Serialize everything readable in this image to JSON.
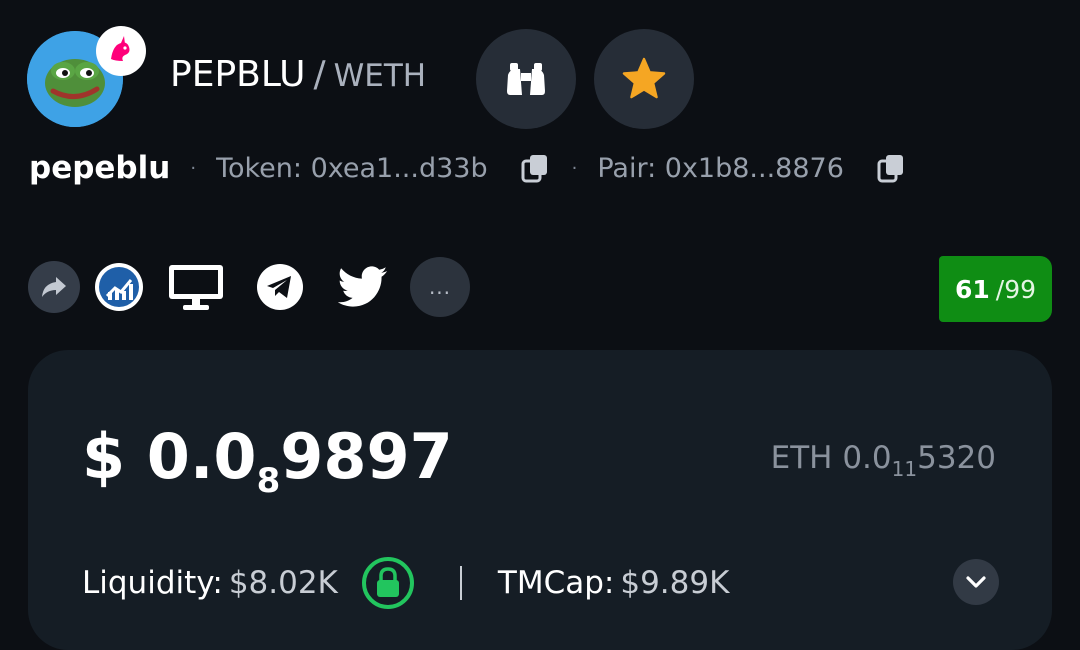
{
  "header": {
    "base_symbol": "PEPBLU",
    "separator": "/",
    "quote_symbol": "WETH",
    "token_name": "pepeblu",
    "token_address": "Token: 0xea1...d33b",
    "pair_address": "Pair: 0x1b8...8876",
    "dot": "·"
  },
  "links": {
    "more_label": "..."
  },
  "score": {
    "value": "61",
    "total": "/99"
  },
  "price": {
    "usd_prefix": "$ 0.0",
    "usd_zeros": "8",
    "usd_digits": "9897",
    "eth_prefix": "ETH 0.0",
    "eth_zeros": "11",
    "eth_digits": "5320"
  },
  "stats": {
    "liquidity_label": "Liquidity:",
    "liquidity_value": "$8.02K",
    "tmcap_label": "TMCap:",
    "tmcap_value": "$9.89K"
  },
  "colors": {
    "background": "#0c0f14",
    "card": "#151d25",
    "score_green": "#0f8d14",
    "star": "#f5a623",
    "lock_green": "#22c55e"
  },
  "icons": [
    "pepe-logo",
    "uniswap-icon",
    "binoculars-icon",
    "star-icon",
    "copy-icon",
    "share-icon",
    "chart-icon",
    "website-icon",
    "telegram-icon",
    "twitter-icon",
    "lock-icon",
    "chevron-down-icon"
  ]
}
